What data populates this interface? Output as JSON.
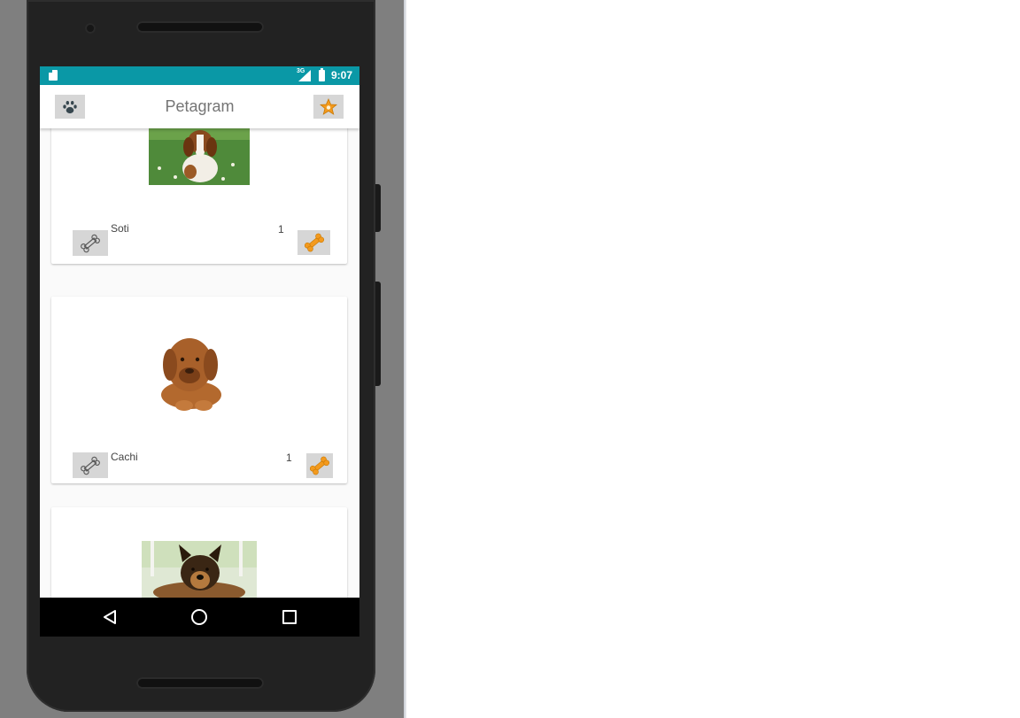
{
  "colors": {
    "status_bar": "#0a98a6",
    "accent": "#f39a1e",
    "title_text": "#757575"
  },
  "status_bar": {
    "network": "3G",
    "time": "9:07"
  },
  "app_bar": {
    "title": "Petagram",
    "left_icon": "paw-icon",
    "right_icon": "star-icon"
  },
  "pets": [
    {
      "name": "Soti",
      "likes": "1",
      "photo": "beagle-photo"
    },
    {
      "name": "Cachi",
      "likes": "1",
      "photo": "dogue-puppy-photo"
    },
    {
      "name": "",
      "likes": "",
      "photo": "german-shepherd-photo"
    }
  ],
  "nav_bar": {
    "back_icon": "back-triangle-icon",
    "home_icon": "home-circle-icon",
    "recent_icon": "recent-square-icon"
  }
}
